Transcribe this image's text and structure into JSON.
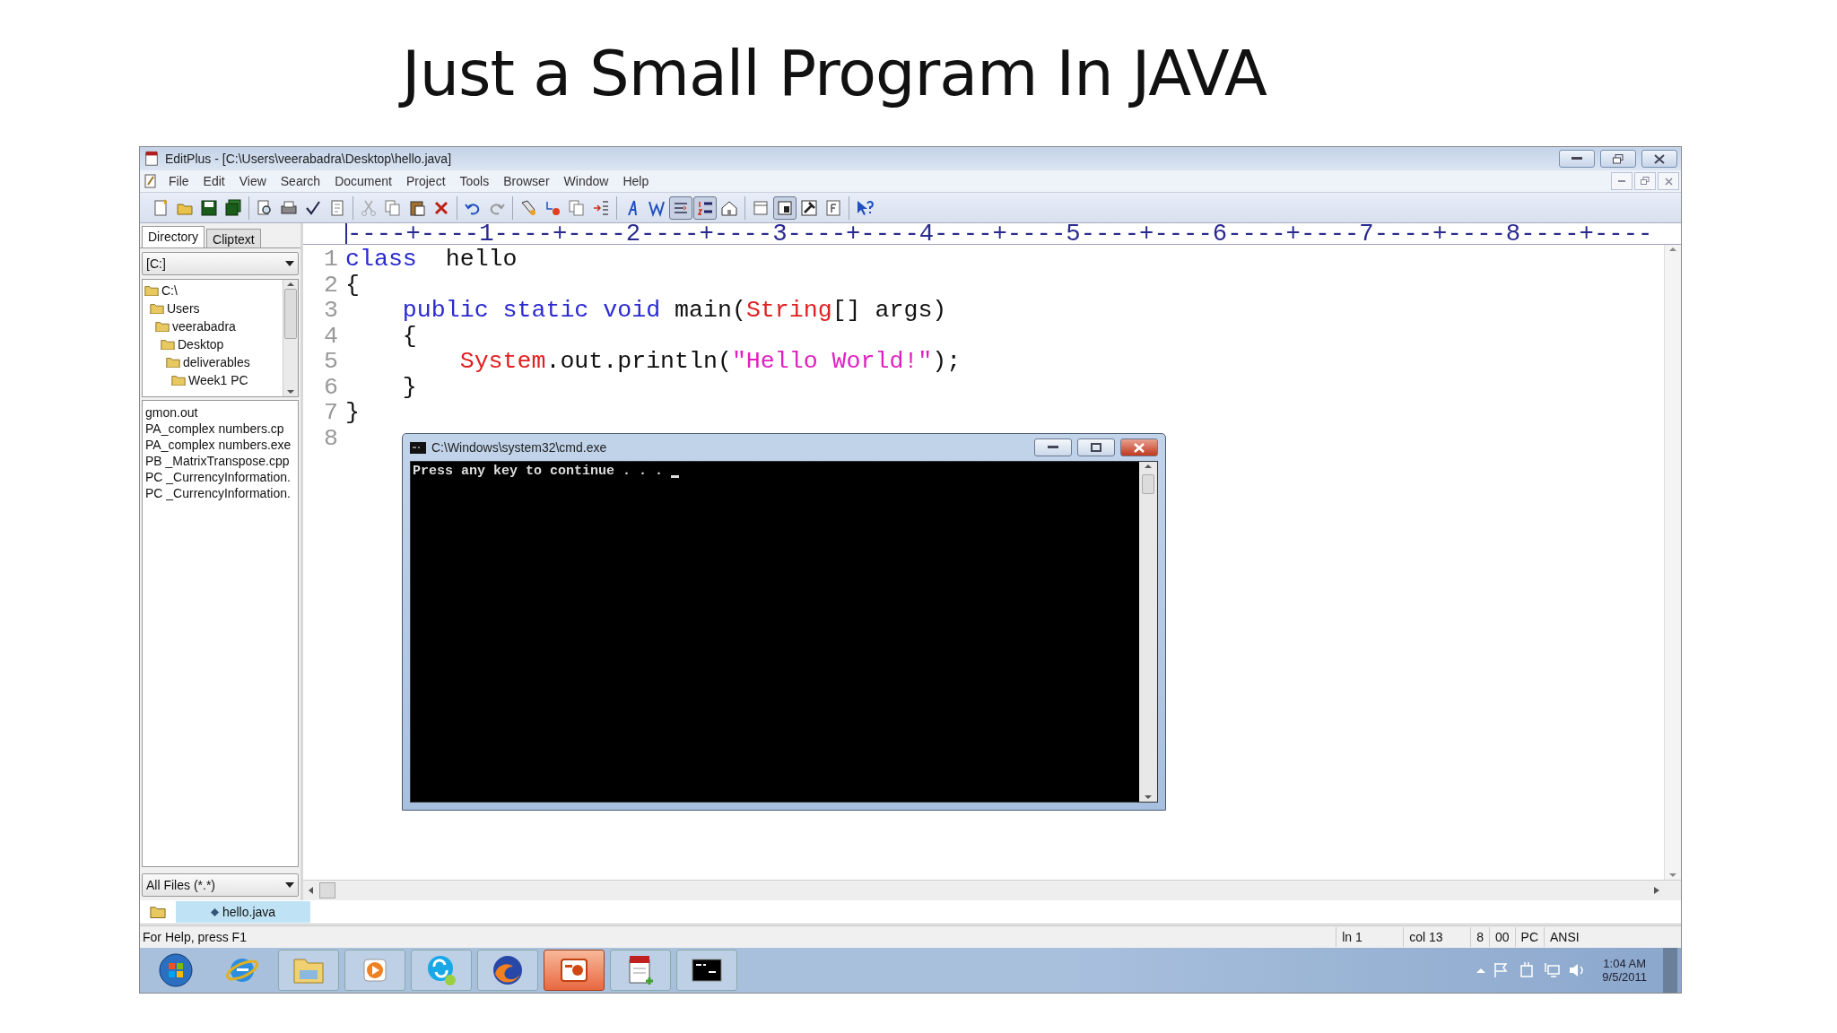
{
  "slide_title": "Just a Small Program In JAVA",
  "window": {
    "title": "EditPlus - [C:\\Users\\veerabadra\\Desktop\\hello.java]"
  },
  "menu": [
    "File",
    "Edit",
    "View",
    "Search",
    "Document",
    "Project",
    "Tools",
    "Browser",
    "Window",
    "Help"
  ],
  "toolbar_groups": [
    {
      "buttons": [
        {
          "kind": "new",
          "pressed": false
        },
        {
          "kind": "open",
          "pressed": false
        },
        {
          "kind": "save",
          "pressed": false
        },
        {
          "kind": "save-all",
          "pressed": false
        }
      ]
    },
    {
      "buttons": [
        {
          "kind": "preview",
          "pressed": false
        },
        {
          "kind": "print",
          "pressed": false
        },
        {
          "kind": "spell",
          "pressed": false
        },
        {
          "kind": "page",
          "pressed": false
        }
      ]
    },
    {
      "buttons": [
        {
          "kind": "cut",
          "pressed": false
        },
        {
          "kind": "copy",
          "pressed": false
        },
        {
          "kind": "paste",
          "pressed": false
        },
        {
          "kind": "delete",
          "pressed": false
        }
      ]
    },
    {
      "buttons": [
        {
          "kind": "undo",
          "pressed": false
        },
        {
          "kind": "redo",
          "pressed": false
        }
      ]
    },
    {
      "buttons": [
        {
          "kind": "find",
          "pressed": false
        },
        {
          "kind": "replace",
          "pressed": false
        },
        {
          "kind": "copy",
          "pressed": false
        },
        {
          "kind": "indent",
          "pressed": false
        }
      ]
    },
    {
      "buttons": [
        {
          "kind": "font",
          "pressed": false
        },
        {
          "kind": "word",
          "pressed": false
        },
        {
          "kind": "wrap",
          "pressed": true
        },
        {
          "kind": "numbers",
          "pressed": true
        },
        {
          "kind": "house",
          "pressed": false
        }
      ]
    },
    {
      "buttons": [
        {
          "kind": "panel",
          "pressed": false
        },
        {
          "kind": "screen",
          "pressed": true
        },
        {
          "kind": "hammer",
          "pressed": false
        },
        {
          "kind": "form",
          "pressed": false
        }
      ]
    },
    {
      "buttons": [
        {
          "kind": "help",
          "pressed": false
        }
      ]
    }
  ],
  "sidebar": {
    "tabs": [
      {
        "label": "Directory",
        "selected": true
      },
      {
        "label": "Cliptext",
        "selected": false
      }
    ],
    "drive": "[C:]",
    "tree": [
      {
        "label": "C:\\",
        "children": [
          {
            "label": "Users",
            "children": [
              {
                "label": "veerabadra",
                "children": [
                  {
                    "label": "Desktop",
                    "children": [
                      {
                        "label": "deliverables",
                        "children": [
                          {
                            "label": "Week1 PC"
                          }
                        ]
                      }
                    ]
                  }
                ]
              }
            ]
          }
        ]
      }
    ],
    "files": [
      "gmon.out",
      "PA_complex numbers.cp",
      "PA_complex numbers.exe",
      "PB _MatrixTranspose.cpp",
      "PC _CurrencyInformation.",
      "PC _CurrencyInformation."
    ],
    "filter": "All Files (*.*)"
  },
  "editor": {
    "ruler": "----+----1----+----2----+----3----+----4----+----5----+----6----+----7----+----8----+----",
    "lines": [
      {
        "number": "1",
        "tokens": [
          {
            "text": "class",
            "kind": "keyword"
          },
          {
            "text": "  hello",
            "kind": "plain"
          }
        ]
      },
      {
        "number": "2",
        "tokens": [
          {
            "text": "{",
            "kind": "plain"
          }
        ]
      },
      {
        "number": "3",
        "tokens": [
          {
            "text": "    public static void",
            "kind": "keyword"
          },
          {
            "text": " main(",
            "kind": "plain"
          },
          {
            "text": "String",
            "kind": "type"
          },
          {
            "text": "[] args)",
            "kind": "plain"
          }
        ]
      },
      {
        "number": "4",
        "tokens": [
          {
            "text": "    {",
            "kind": "plain"
          }
        ]
      },
      {
        "number": "5",
        "tokens": [
          {
            "text": "        System",
            "kind": "type"
          },
          {
            "text": ".out.println(",
            "kind": "plain"
          },
          {
            "text": "\"Hello World!\"",
            "kind": "string"
          },
          {
            "text": ");",
            "kind": "plain"
          }
        ]
      },
      {
        "number": "6",
        "tokens": [
          {
            "text": "    }",
            "kind": "plain"
          }
        ]
      },
      {
        "number": "7",
        "tokens": [
          {
            "text": "}",
            "kind": "plain"
          }
        ]
      },
      {
        "number": "8"
      }
    ]
  },
  "doc_tabs": [
    {
      "label": "hello.java",
      "selected": true
    }
  ],
  "console": {
    "title": "C:\\Windows\\system32\\cmd.exe",
    "output": "Press any key to continue . . . "
  },
  "status_bar": {
    "help": "For Help, press F1",
    "fields": [
      "ln 1",
      "col 13",
      "8",
      "00",
      "PC",
      "ANSI"
    ]
  },
  "taskbar": {
    "apps": [
      {
        "kind": "start",
        "selected": false
      },
      {
        "kind": "globe",
        "selected": false
      },
      {
        "kind": "folder",
        "selected": false
      },
      {
        "kind": "media",
        "selected": false
      },
      {
        "kind": "chat",
        "selected": false
      },
      {
        "kind": "fox",
        "selected": false
      },
      {
        "kind": "slides",
        "selected": true
      },
      {
        "kind": "notepad",
        "selected": false
      },
      {
        "kind": "terminal",
        "selected": false
      }
    ],
    "time": "1:04 AM",
    "date": "9/5/2011"
  }
}
